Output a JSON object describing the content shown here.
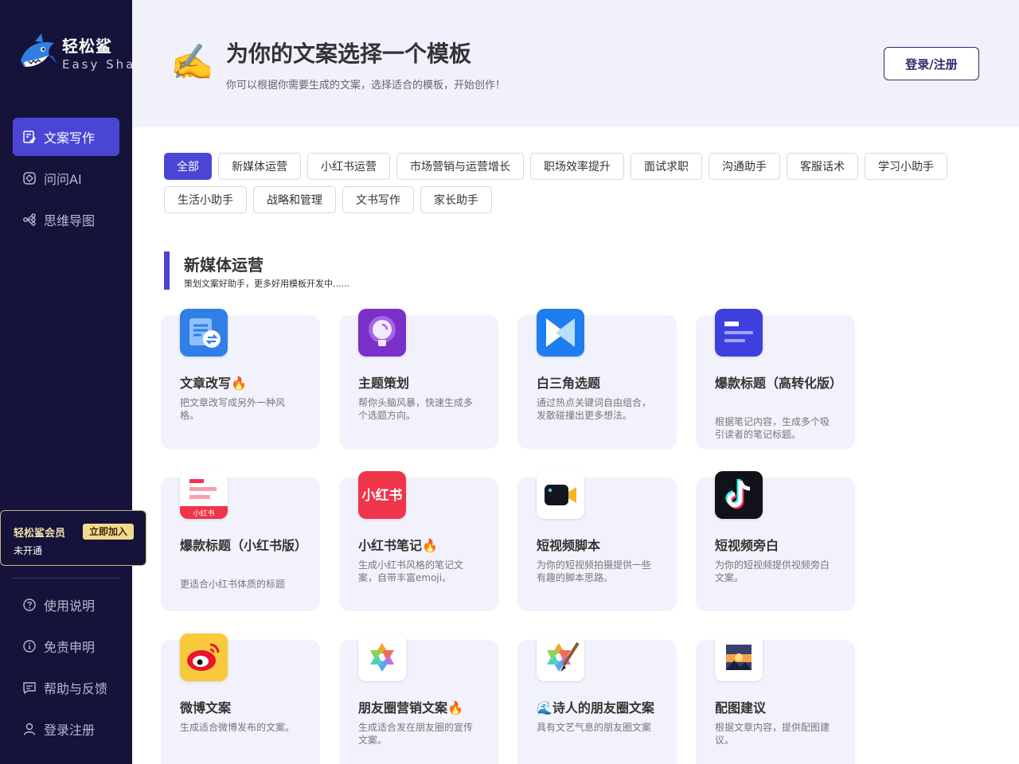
{
  "brand": {
    "name": "轻松鲨",
    "sub": "Easy Shark"
  },
  "nav": {
    "items": [
      {
        "label": "文案写作",
        "icon": "edit-icon"
      },
      {
        "label": "问问AI",
        "icon": "ai-chat-icon"
      },
      {
        "label": "思维导图",
        "icon": "mindmap-icon"
      }
    ],
    "active": 0
  },
  "vip": {
    "title": "轻松鲨会员",
    "button": "立即加入",
    "status": "未开通"
  },
  "bottom_nav": [
    {
      "label": "使用说明",
      "icon": "help-circle-icon"
    },
    {
      "label": "免责申明",
      "icon": "info-circle-icon"
    },
    {
      "label": "帮助与反馈",
      "icon": "feedback-icon"
    },
    {
      "label": "登录注册",
      "icon": "user-icon"
    }
  ],
  "header": {
    "emoji": "✍️",
    "title": "为你的文案选择一个模板",
    "subtitle": "你可以根据你需要生成的文案，选择适合的模板，开始创作！",
    "login_button": "登录/注册"
  },
  "tags": [
    "全部",
    "新媒体运营",
    "小红书运营",
    "市场营销与运营增长",
    "职场效率提升",
    "面试求职",
    "沟通助手",
    "客服话术",
    "学习小助手",
    "生活小助手",
    "战略和管理",
    "文书写作",
    "家长助手"
  ],
  "active_tag": 0,
  "section": {
    "title": "新媒体运营",
    "subtitle": "策划文案好助手，更多好用模板开发中......"
  },
  "cards": [
    {
      "title": "文章改写🔥",
      "desc": "把文章改写成另外一种风格。",
      "icon": "article-rewrite-icon"
    },
    {
      "title": "主题策划",
      "desc": "帮你头脑风暴，快速生成多个选题方向。",
      "icon": "lightbulb-icon"
    },
    {
      "title": "白三角选题",
      "desc": "通过热点关键词自由组合，发散碰撞出更多想法。",
      "icon": "triangle-play-icon"
    },
    {
      "title": "爆款标题（高转化版）",
      "desc": "根据笔记内容，生成多个吸引读者的笔记标题。",
      "icon": "headline-icon"
    },
    {
      "title": "爆款标题（小红书版）",
      "desc": "更适合小红书体质的标题",
      "icon": "xiaohongshu-note-icon"
    },
    {
      "title": "小红书笔记🔥",
      "desc": "生成小红书风格的笔记文案，自带丰富emoji。",
      "icon": "xiaohongshu-logo-icon"
    },
    {
      "title": "短视频脚本",
      "desc": "为你的短视频拍摄提供一些有趣的脚本思路。",
      "icon": "video-camera-icon"
    },
    {
      "title": "短视频旁白",
      "desc": "为你的短视频提供视频旁白文案。",
      "icon": "tiktok-icon"
    },
    {
      "title": "微博文案",
      "desc": "生成适合微博发布的文案。",
      "icon": "weibo-icon"
    },
    {
      "title": "朋友圈营销文案🔥",
      "desc": "生成适合发在朋友圈的宣传文案。",
      "icon": "moments-icon"
    },
    {
      "title": "🌊诗人的朋友圈文案",
      "desc": "具有文艺气息的朋友圈文案",
      "icon": "moments-brush-icon"
    },
    {
      "title": "配图建议",
      "desc": "根据文章内容，提供配图建议。",
      "icon": "picture-icon"
    }
  ]
}
